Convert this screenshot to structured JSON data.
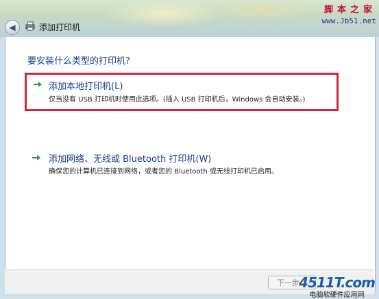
{
  "window": {
    "title": "添加打印机",
    "back_glyph": "◀"
  },
  "watermark_top": {
    "line1": "脚本之家",
    "line2": "www.Jb51.net"
  },
  "main": {
    "heading": "要安装什么类型的打印机?",
    "options": [
      {
        "title": "添加本地打印机(L)",
        "description": "仅当没有 USB 打印机时使用此选项。(插入 USB 打印机后，Windows 会自动安装。)"
      },
      {
        "title": "添加网络、无线或 Bluetooth 打印机(W)",
        "description": "确保您的计算机已连接到网络，或者您的 Bluetooth 或无线打印机已启用。"
      }
    ]
  },
  "footer": {
    "next_label": "下一步"
  },
  "watermark_bottom": {
    "brand": "4511T.com",
    "tagline": "电脑软硬件应用网"
  },
  "colors": {
    "link_blue": "#1d3b8a",
    "highlight_red": "#d0263b",
    "arrow_green": "#2e9d2e"
  }
}
